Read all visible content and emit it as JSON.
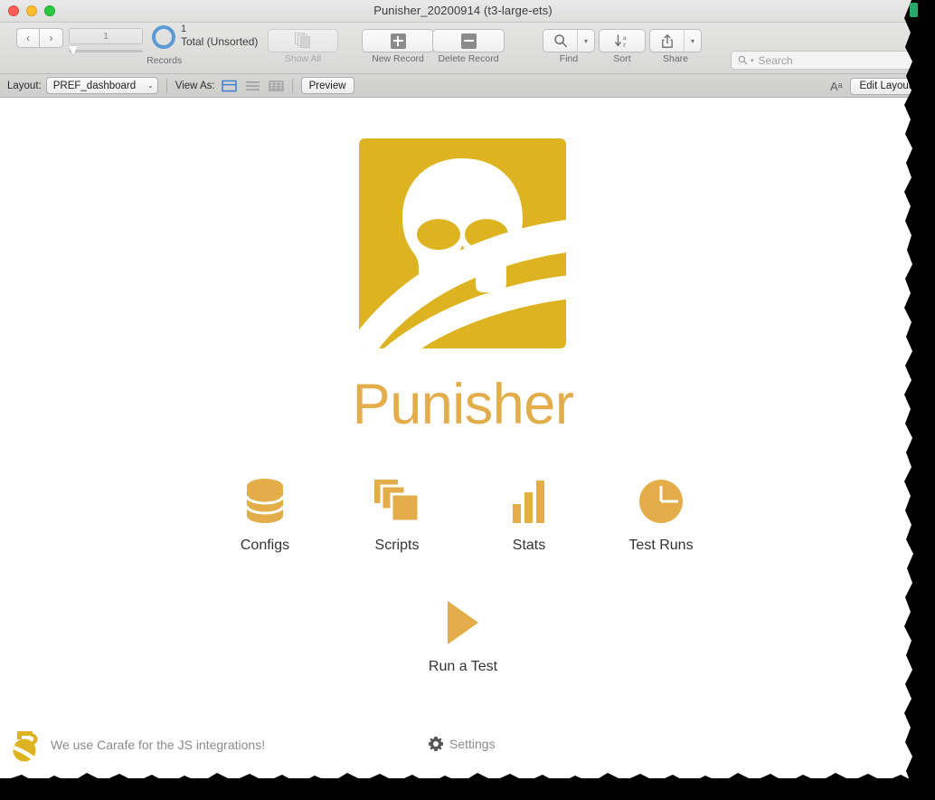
{
  "window": {
    "title": "Punisher_20200914 (t3-large-ets)",
    "traffic_lights": [
      "close",
      "minimize",
      "zoom"
    ],
    "colors": {
      "brand_gold": "#DDB321",
      "title_gold": "#E3AD4B",
      "icon_gold": "#E3AE49",
      "accent_blue": "#5B9BD5"
    }
  },
  "toolbar": {
    "records": {
      "field_value": "1",
      "count": "1",
      "total_label": "Total (Unsorted)",
      "caption": "Records",
      "prev_label": "‹",
      "next_label": "›"
    },
    "show_all": {
      "caption": "Show All",
      "enabled": false
    },
    "new_record": {
      "caption": "New Record",
      "icon": "plus-icon"
    },
    "delete_record": {
      "caption": "Delete Record",
      "icon": "minus-icon"
    },
    "find": {
      "caption": "Find",
      "icon": "magnifier-icon"
    },
    "sort": {
      "caption": "Sort",
      "icon": "sort-az-icon"
    },
    "share": {
      "caption": "Share",
      "icon": "share-upload-icon"
    },
    "search": {
      "placeholder": "Search",
      "value": ""
    }
  },
  "layout_bar": {
    "layout_label": "Layout:",
    "layout_value": "PREF_dashboard",
    "view_as_label": "View As:",
    "view_modes": [
      {
        "name": "form-view",
        "selected": true
      },
      {
        "name": "list-view",
        "selected": false
      },
      {
        "name": "table-view",
        "selected": false
      }
    ],
    "preview_label": "Preview",
    "text_format_label": "Aᵃ",
    "edit_layout_label": "Edit Layout"
  },
  "content": {
    "logo_alt": "punisher-skull-logo",
    "app_title": "Punisher",
    "nav_icons": [
      {
        "label": "Configs",
        "icon": "database-icon"
      },
      {
        "label": "Scripts",
        "icon": "copy-stack-icon"
      },
      {
        "label": "Stats",
        "icon": "bar-chart-icon"
      },
      {
        "label": "Test Runs",
        "icon": "clock-icon"
      }
    ],
    "primary_action": {
      "label": "Run a Test",
      "icon": "play-triangle-icon"
    }
  },
  "footer": {
    "carafe_text": "We use Carafe for the JS integrations!",
    "carafe_icon": "carafe-pitcher-icon",
    "settings_label": "Settings",
    "settings_icon": "gear-icon"
  }
}
